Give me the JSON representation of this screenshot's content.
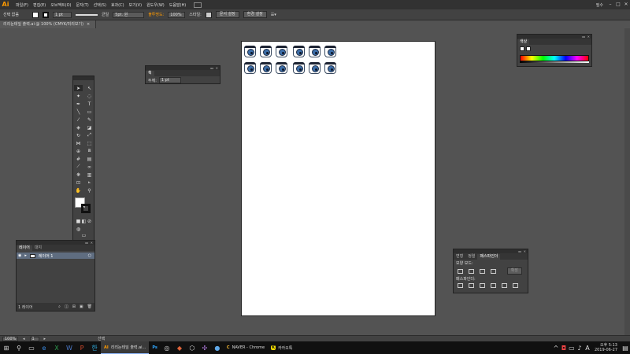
{
  "app": {
    "logo": "Ai"
  },
  "menu": [
    "파일(F)",
    "편집(E)",
    "오브젝트(O)",
    "문자(T)",
    "선택(S)",
    "효과(C)",
    "보기(V)",
    "윈도우(W)",
    "도움말(H)"
  ],
  "workspace": "필수",
  "window_controls": [
    "–",
    "□",
    "✕"
  ],
  "control_bar": {
    "selection_label": "선택 없음",
    "stroke_weight": "1 pt",
    "brush_label": "균일",
    "brush_value": "5pt. 원",
    "opacity_label": "불투명도:",
    "opacity_value": "100%",
    "style_label": "스타일:",
    "doc_setup_btn": "문서 설정",
    "prefs_btn": "환경 설정"
  },
  "doc_tab": {
    "title": "리리눈테잎 출력.ai @ 100% (CMYK/미리보기)",
    "close": "×"
  },
  "stroke_panel": {
    "title": "획",
    "weight_label": "두께:",
    "weight_value": "1 pt"
  },
  "color_panel": {
    "title": "색상"
  },
  "layers_panel": {
    "tabs": [
      "레이어",
      "대지"
    ],
    "layer_name": "레이어 1",
    "footer_count": "1 레이어"
  },
  "pathfinder_panel": {
    "tabs": [
      "변형",
      "정렬",
      "패스파인더"
    ],
    "shape_modes_label": "모양 모드:",
    "expand_btn": "확장",
    "pathfinders_label": "패스파인더:"
  },
  "status_bar": {
    "zoom": "100%",
    "page": "1",
    "tool_label": "선택"
  },
  "taskbar": {
    "apps": [
      {
        "icon": "AI",
        "label": "리리눈테잎 출력.ai..."
      },
      {
        "icon": "Ps",
        "label": ""
      },
      {
        "icon": "C",
        "label": "NAVER - Chrome"
      },
      {
        "icon": "K",
        "label": "카카오톡"
      }
    ],
    "clock_time": "오후 5:13",
    "clock_date": "2019-06-27"
  },
  "colors": {
    "accent": "#ff9a00",
    "selection": "#5f6d80"
  }
}
